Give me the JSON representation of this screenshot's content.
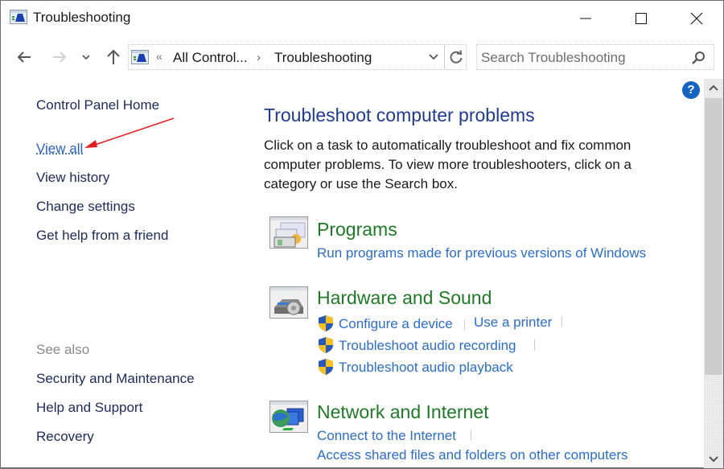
{
  "window": {
    "title": "Troubleshooting",
    "controls": {
      "minimize": "minimize",
      "maximize": "maximize",
      "close": "close"
    }
  },
  "nav": {
    "back_icon": "arrow-left-icon",
    "forward_icon": "arrow-right-icon",
    "recent_icon": "chevron-down-icon",
    "up_icon": "arrow-up-icon",
    "overflow": "«",
    "breadcrumbs": [
      "All Control...",
      "Troubleshooting"
    ],
    "separator": "›"
  },
  "search": {
    "placeholder": "Search Troubleshooting",
    "value": ""
  },
  "left_pane": {
    "home": "Control Panel Home",
    "links": [
      "View all",
      "View history",
      "Change settings",
      "Get help from a friend"
    ],
    "active_link": "View all",
    "see_also_label": "See also",
    "see_also": [
      "Security and Maintenance",
      "Help and Support",
      "Recovery"
    ]
  },
  "annotation": {
    "arrow_color": "#e02020",
    "target": "View all"
  },
  "main": {
    "title": "Troubleshoot computer problems",
    "description": "Click on a task to automatically troubleshoot and fix common computer problems. To view more troubleshooters, click on a category or use the Search box.",
    "categories": [
      {
        "title": "Programs",
        "icon": "programs-icon",
        "tasks": [
          {
            "label": "Run programs made for previous versions of Windows",
            "shield": false
          }
        ]
      },
      {
        "title": "Hardware and Sound",
        "icon": "hardware-sound-icon",
        "tasks": [
          {
            "label": "Configure a device",
            "shield": true
          },
          {
            "label": "Use a printer",
            "shield": false
          },
          {
            "label": "Troubleshoot audio recording",
            "shield": true
          },
          {
            "label": "Troubleshoot audio playback",
            "shield": true
          }
        ]
      },
      {
        "title": "Network and Internet",
        "icon": "network-internet-icon",
        "tasks": [
          {
            "label": "Connect to the Internet",
            "shield": false
          },
          {
            "label": "Access shared files and folders on other computers",
            "shield": false
          }
        ]
      }
    ],
    "help": "?"
  },
  "colors": {
    "link": "#2a6dcc",
    "category": "#1e7a26",
    "heading": "#1f3a93",
    "left_link": "#1c2a5c",
    "help_button": "#1565c0"
  }
}
